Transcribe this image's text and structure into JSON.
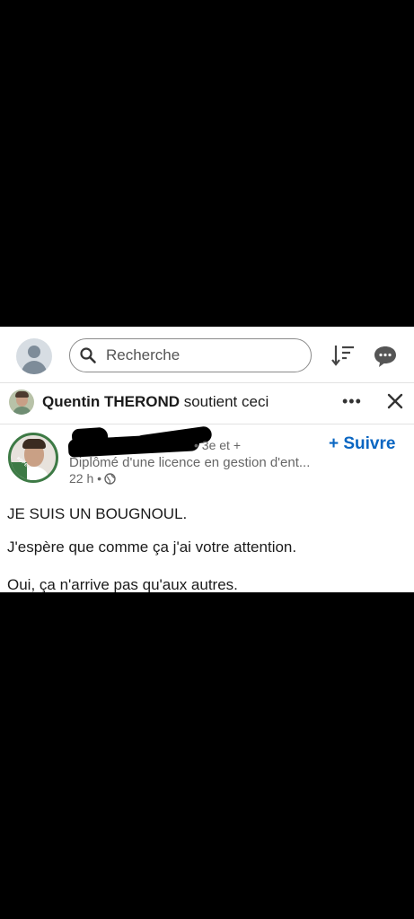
{
  "search": {
    "placeholder": "Recherche"
  },
  "context": {
    "name": "Quentin THEROND",
    "action": " soutient ceci"
  },
  "post": {
    "degree": "• 3e et +",
    "headline": "Diplômé d'une licence en gestion d'ent...",
    "time": "22 h •",
    "follow_label": "+ Suivre",
    "avatar_badge": "#OPENTOWORK",
    "paragraphs": [
      "JE SUIS UN BOUGNOUL.",
      "J'espère que comme ça j'ai votre attention.",
      "Oui, ça n'arrive pas qu'aux autres."
    ]
  },
  "colors": {
    "accent": "#0a66c2",
    "open_to_work": "#3d7a45"
  },
  "icons": [
    "search-icon",
    "sort-icon",
    "message-icon",
    "more-icon",
    "close-icon",
    "globe-icon"
  ]
}
